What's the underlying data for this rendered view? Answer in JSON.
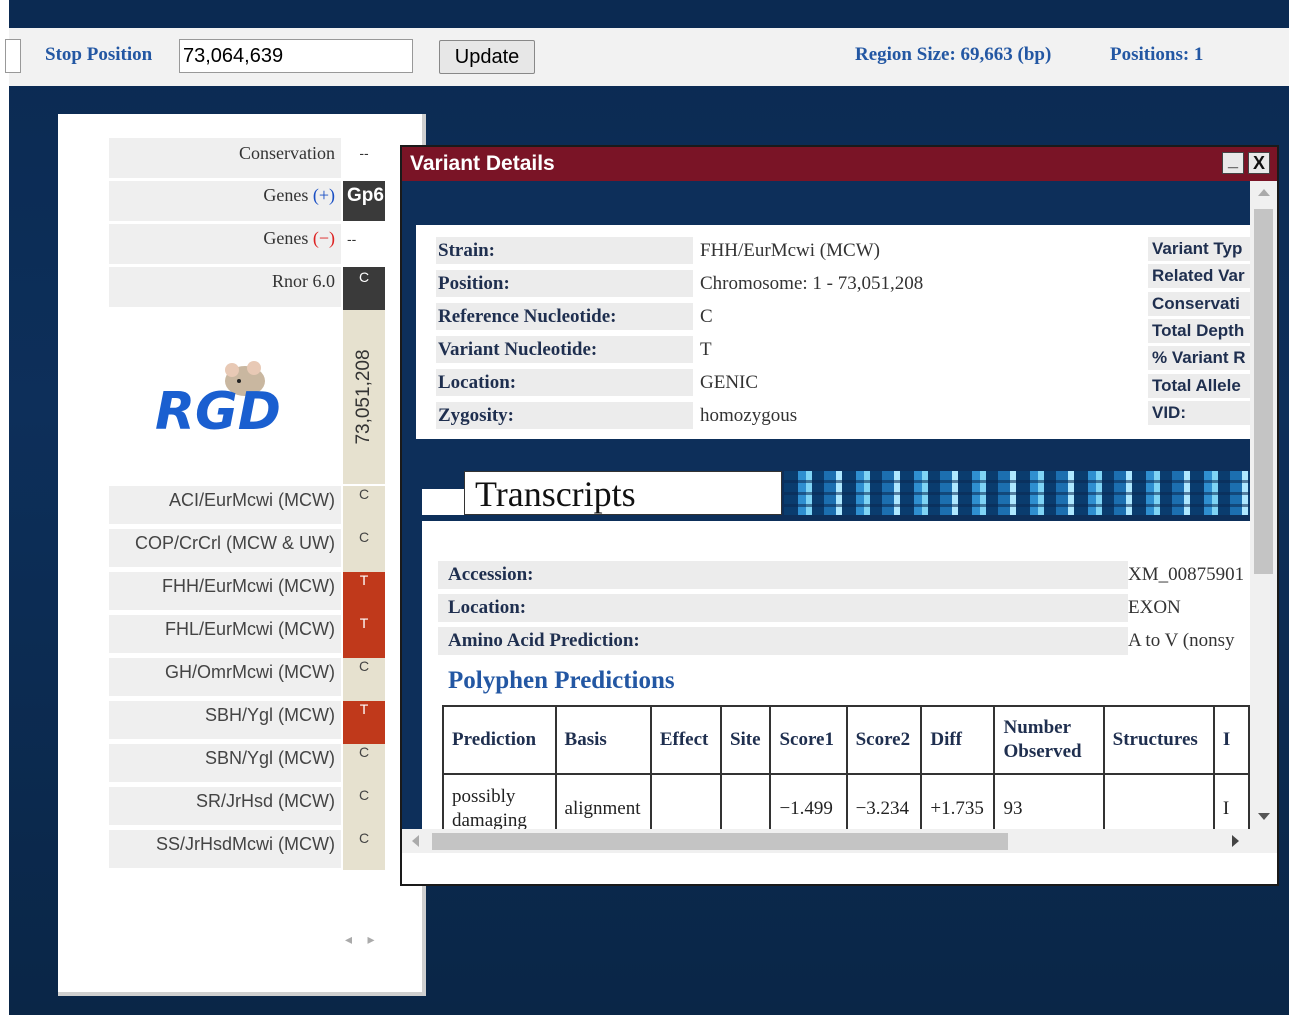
{
  "topbar": {
    "stop_position_label": "Stop Position",
    "stop_position_value": "73,064,639",
    "update_button": "Update",
    "region_size": "Region Size: 69,663 (bp)",
    "positions": "Positions: 1"
  },
  "track_panel": {
    "header_rows": [
      {
        "label": "Conservation",
        "cell": "--"
      },
      {
        "label": "Genes",
        "sign": "(+)",
        "cell": "Gp6"
      },
      {
        "label": "Genes",
        "sign": "(−)",
        "cell": "--"
      },
      {
        "label": "Rnor 6.0",
        "cell": "C"
      }
    ],
    "logo_text": "RGD",
    "position_label": "73,051,208",
    "strains": [
      {
        "name": "ACI/EurMcwi (MCW)",
        "nucleotide": "C",
        "variant": false
      },
      {
        "name": "COP/CrCrl (MCW & UW)",
        "nucleotide": "C",
        "variant": false
      },
      {
        "name": "FHH/EurMcwi (MCW)",
        "nucleotide": "T",
        "variant": true
      },
      {
        "name": "FHL/EurMcwi (MCW)",
        "nucleotide": "T",
        "variant": true
      },
      {
        "name": "GH/OmrMcwi (MCW)",
        "nucleotide": "C",
        "variant": false
      },
      {
        "name": "SBH/Ygl (MCW)",
        "nucleotide": "T",
        "variant": true
      },
      {
        "name": "SBN/Ygl (MCW)",
        "nucleotide": "C",
        "variant": false
      },
      {
        "name": "SR/JrHsd (MCW)",
        "nucleotide": "C",
        "variant": false
      },
      {
        "name": "SS/JrHsdMcwi (MCW)",
        "nucleotide": "C",
        "variant": false
      }
    ],
    "colors": {
      "variant": "#c0391b",
      "reference": "#e6e1cf",
      "gene": "#3a3a3a"
    }
  },
  "dialog": {
    "title": "Variant Details",
    "minimize": "_",
    "close": "X",
    "details": [
      {
        "label": "Strain:",
        "value": "FHH/EurMcwi (MCW)"
      },
      {
        "label": "Position:",
        "value": "Chromosome: 1 - 73,051,208"
      },
      {
        "label": "Reference Nucleotide:",
        "value": "C"
      },
      {
        "label": "Variant Nucleotide:",
        "value": "T"
      },
      {
        "label": "Location:",
        "value": "GENIC"
      },
      {
        "label": "Zygosity:",
        "value": "homozygous"
      }
    ],
    "right_labels": [
      "Variant Typ",
      "Related Var",
      "Conservati",
      "Total Depth",
      "% Variant R",
      "Total Allele",
      "VID:"
    ],
    "transcripts_title": "Transcripts",
    "transcript": [
      {
        "label": "Accession:",
        "value": "XM_00875901"
      },
      {
        "label": "Location:",
        "value": "EXON"
      },
      {
        "label": "Amino Acid Prediction:",
        "value": "A to V (nonsy"
      }
    ],
    "polyphen_title": "Polyphen Predictions",
    "polyphen_headers": [
      "Prediction",
      "Basis",
      "Effect",
      "Site",
      "Score1",
      "Score2",
      "Diff",
      "Number Observed",
      "Structures",
      "I"
    ],
    "polyphen_row": [
      "possibly damaging",
      "alignment",
      "",
      "",
      "−1.499",
      "−3.234",
      "+1.735",
      "93",
      "",
      "I"
    ]
  }
}
